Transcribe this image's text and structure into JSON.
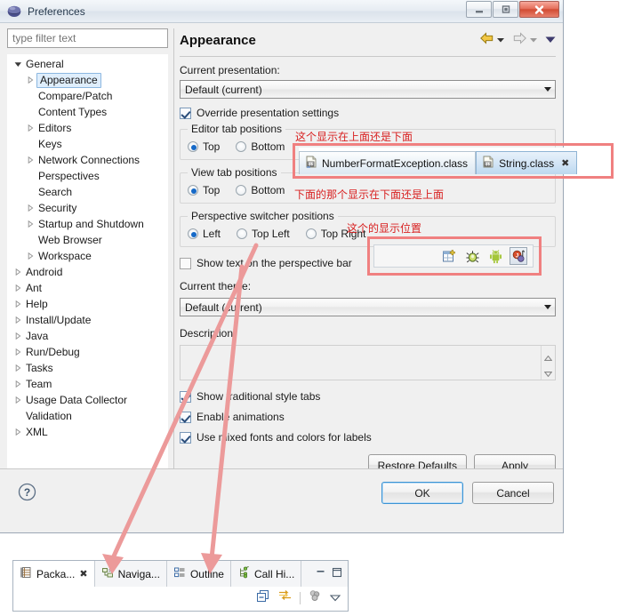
{
  "window": {
    "title": "Preferences",
    "buttons": {
      "minimize": "Minimize",
      "maximize": "Maximize",
      "close": "Close"
    }
  },
  "sidebar": {
    "filter_placeholder": "type filter text",
    "filter_value": "",
    "items": [
      {
        "label": "General",
        "indent": 0,
        "twisty": "down",
        "selected": false
      },
      {
        "label": "Appearance",
        "indent": 1,
        "twisty": "right",
        "selected": true
      },
      {
        "label": "Compare/Patch",
        "indent": 1,
        "twisty": "none",
        "selected": false
      },
      {
        "label": "Content Types",
        "indent": 1,
        "twisty": "none",
        "selected": false
      },
      {
        "label": "Editors",
        "indent": 1,
        "twisty": "right",
        "selected": false
      },
      {
        "label": "Keys",
        "indent": 1,
        "twisty": "none",
        "selected": false
      },
      {
        "label": "Network Connections",
        "indent": 1,
        "twisty": "right",
        "selected": false
      },
      {
        "label": "Perspectives",
        "indent": 1,
        "twisty": "none",
        "selected": false
      },
      {
        "label": "Search",
        "indent": 1,
        "twisty": "none",
        "selected": false
      },
      {
        "label": "Security",
        "indent": 1,
        "twisty": "right",
        "selected": false
      },
      {
        "label": "Startup and Shutdown",
        "indent": 1,
        "twisty": "right",
        "selected": false
      },
      {
        "label": "Web Browser",
        "indent": 1,
        "twisty": "none",
        "selected": false
      },
      {
        "label": "Workspace",
        "indent": 1,
        "twisty": "right",
        "selected": false
      },
      {
        "label": "Android",
        "indent": 0,
        "twisty": "right",
        "selected": false
      },
      {
        "label": "Ant",
        "indent": 0,
        "twisty": "right",
        "selected": false
      },
      {
        "label": "Help",
        "indent": 0,
        "twisty": "right",
        "selected": false
      },
      {
        "label": "Install/Update",
        "indent": 0,
        "twisty": "right",
        "selected": false
      },
      {
        "label": "Java",
        "indent": 0,
        "twisty": "right",
        "selected": false
      },
      {
        "label": "Run/Debug",
        "indent": 0,
        "twisty": "right",
        "selected": false
      },
      {
        "label": "Tasks",
        "indent": 0,
        "twisty": "right",
        "selected": false
      },
      {
        "label": "Team",
        "indent": 0,
        "twisty": "right",
        "selected": false
      },
      {
        "label": "Usage Data Collector",
        "indent": 0,
        "twisty": "right",
        "selected": false
      },
      {
        "label": "Validation",
        "indent": 0,
        "twisty": "none",
        "selected": false
      },
      {
        "label": "XML",
        "indent": 0,
        "twisty": "right",
        "selected": false
      }
    ]
  },
  "page": {
    "title": "Appearance",
    "presentation_label": "Current presentation:",
    "presentation_value": "Default (current)",
    "override_label": "Override presentation settings",
    "override_checked": true,
    "editor_tab_group": {
      "title": "Editor tab positions",
      "options": [
        "Top",
        "Bottom"
      ],
      "selected": "Top"
    },
    "view_tab_group": {
      "title": "View tab positions",
      "options": [
        "Top",
        "Bottom"
      ],
      "selected": "Top"
    },
    "perspective_group": {
      "title": "Perspective switcher positions",
      "options": [
        "Left",
        "Top Left",
        "Top Right"
      ],
      "selected": "Left"
    },
    "show_text_label": "Show text on the perspective bar",
    "show_text_checked": false,
    "theme_label": "Current theme:",
    "theme_value": "Default (current)",
    "description_label": "Description:",
    "description_value": "",
    "checkboxes": [
      {
        "label": "Show traditional style tabs",
        "checked": true
      },
      {
        "label": "Enable animations",
        "checked": true
      },
      {
        "label": "Use mixed fonts and colors for labels",
        "checked": true
      }
    ],
    "restore_defaults": "Restore Defaults",
    "apply": "Apply"
  },
  "footer": {
    "ok": "OK",
    "cancel": "Cancel",
    "help": "?"
  },
  "editor_tabs": [
    {
      "label": "NumberFormatException.class",
      "active": false,
      "closable": false
    },
    {
      "label": "String.class",
      "active": true,
      "closable": true
    }
  ],
  "perspective_bar": {
    "icons": [
      "new-perspective-icon",
      "debug-perspective-icon",
      "android-perspective-icon",
      "java-perspective-icon"
    ],
    "selected": "java-perspective-icon"
  },
  "bottom_panel": {
    "tabs": [
      {
        "label": "Packa...",
        "icon": "package-explorer-icon",
        "active": true,
        "closable": true
      },
      {
        "label": "Naviga...",
        "icon": "navigator-icon",
        "active": false,
        "closable": false
      },
      {
        "label": "Outline",
        "icon": "outline-icon",
        "active": false,
        "closable": false
      },
      {
        "label": "Call Hi...",
        "icon": "call-hierarchy-icon",
        "active": false,
        "closable": false
      }
    ],
    "toolbar_icons": [
      "collapse-all-icon",
      "link-with-editor-icon",
      "view-menu-icon",
      "minimize-icon",
      "maximize-icon"
    ]
  },
  "annotations": [
    {
      "id": "ann-1",
      "text": "这个显示在上面还是下面"
    },
    {
      "id": "ann-2",
      "text": "下面的那个显示在下面还是上面"
    },
    {
      "id": "ann-3",
      "text": "这个的显示位置"
    }
  ],
  "colors": {
    "annotation_red": "#d81f1f",
    "annotation_box": "#f08080",
    "arrow": "#ec9a9a",
    "selection_blue": "#1569c7",
    "dialog_bg": "#f0f0f0"
  }
}
